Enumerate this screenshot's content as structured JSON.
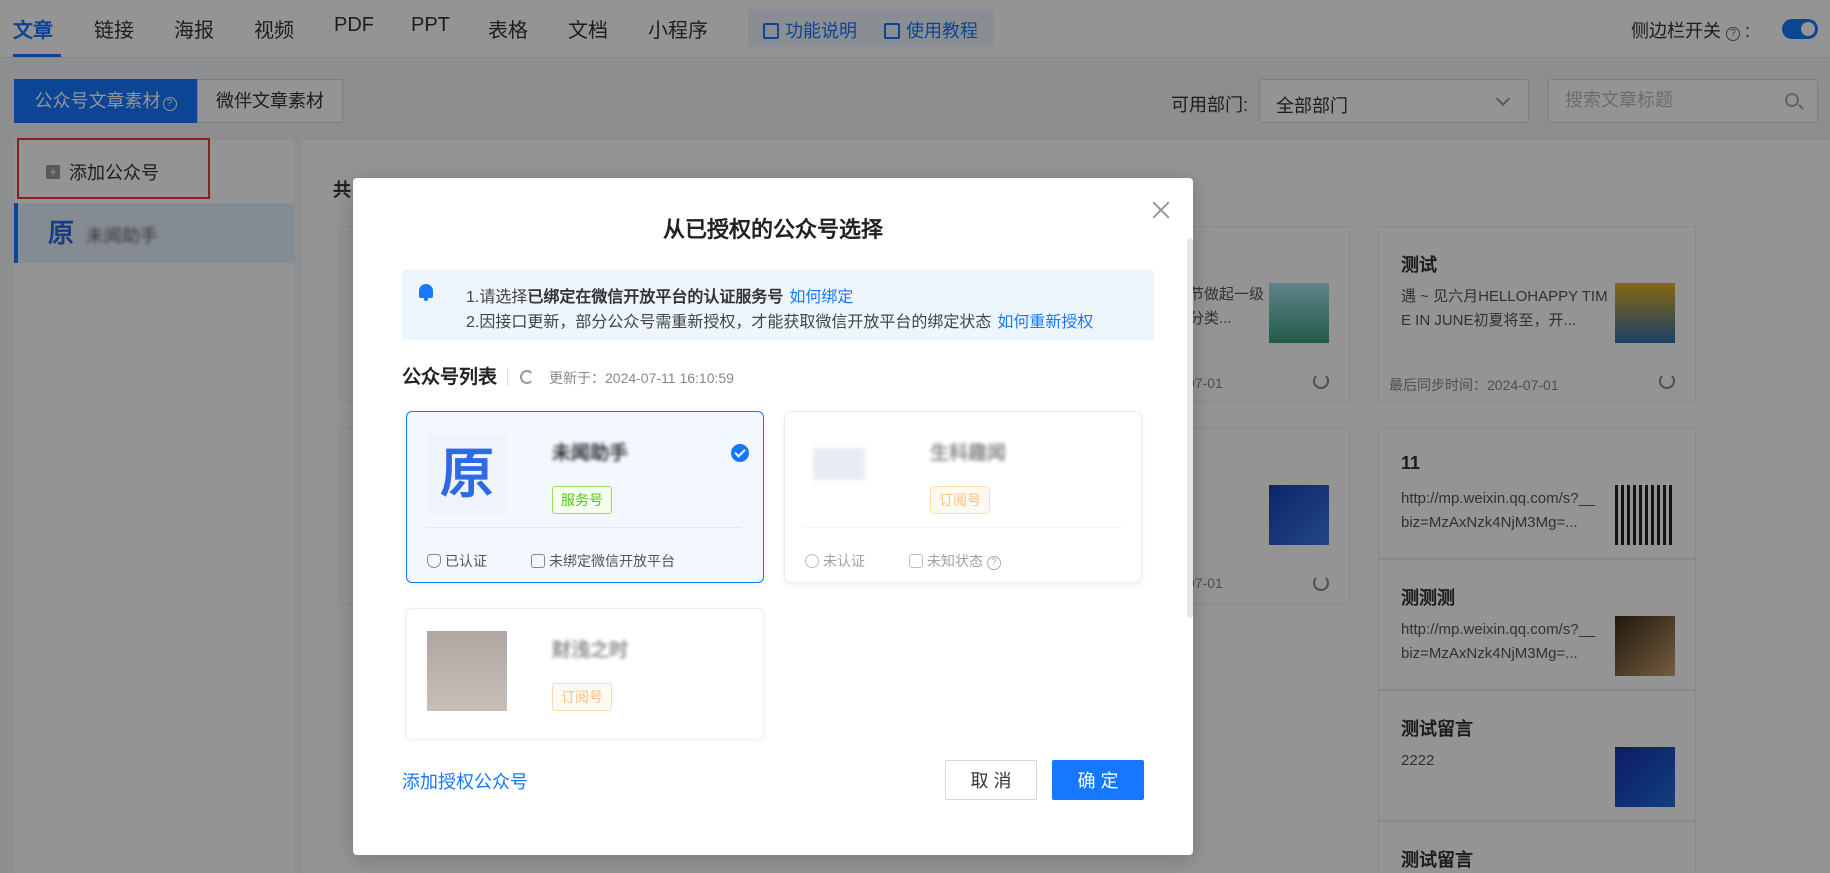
{
  "topbar": {
    "tabs": [
      "文章",
      "链接",
      "海报",
      "视频",
      "PDF",
      "PPT",
      "表格",
      "文档",
      "小程序"
    ],
    "help_links": [
      "功能说明",
      "使用教程"
    ],
    "sidebar_toggle_label": "侧边栏开关",
    "sidebar_toggle_on": true
  },
  "subtabs": [
    "公众号文章素材",
    "微伴文章素材"
  ],
  "filter": {
    "dept_label": "可用部门:",
    "dept_value": "全部部门",
    "search_placeholder": "搜索文章标题"
  },
  "sidebar": {
    "add_label": "添加公众号",
    "account_name": "未闻助手",
    "account_logo": "原"
  },
  "content": {
    "title": "共",
    "cards": [
      {
        "title": "测试",
        "desc": "遇 ~ 见六月HELLOHAPPY TIME IN JUNE初夏将至，开...",
        "sync": "最后同步时间：2024-07-01"
      },
      {
        "title": "",
        "desc": "节做起一级分类...",
        "sync": "07-01"
      },
      {
        "title": "",
        "desc": "",
        "sync": "07-01"
      }
    ],
    "side_items": [
      {
        "title": "11",
        "desc": "http://mp.weixin.qq.com/s?__biz=MzAxNzk4NjM3Mg=..."
      },
      {
        "title": "测测测",
        "desc": "http://mp.weixin.qq.com/s?__biz=MzAxNzk4NjM3Mg=..."
      },
      {
        "title": "测试留言",
        "desc": "2222"
      },
      {
        "title": "测试留言",
        "desc": ""
      }
    ],
    "fragment_labels": [
      "最",
      "最"
    ]
  },
  "dialog": {
    "title": "从已授权的公众号选择",
    "notice_line1_prefix": "1.请选择",
    "notice_line1_bold": "已绑定在微信开放平台的认证服务号",
    "notice_line1_link": "如何绑定",
    "notice_line2": "2.因接口更新，部分公众号需重新授权，才能获取微信开放平台的绑定状态",
    "notice_line2_link": "如何重新授权",
    "list_title": "公众号列表",
    "updated_text": "更新于：2024-07-11 16:10:59",
    "accounts": [
      {
        "name": "未闻助手",
        "type": "服务号",
        "status1": "已认证",
        "status2": "未绑定微信开放平台",
        "selected": true
      },
      {
        "name": "生科趣闻",
        "type": "订阅号",
        "status1": "未认证",
        "status2": "未知状态",
        "selected": false
      },
      {
        "name": "财浅之时",
        "type": "订阅号",
        "status1": "",
        "status2": "",
        "selected": false
      }
    ],
    "add_link": "添加授权公众号",
    "cancel": "取 消",
    "ok": "确 定"
  },
  "colors": {
    "accent": "#1677ff",
    "danger": "#e53935",
    "service": "#52c41a",
    "subscription": "#fa8c16"
  }
}
